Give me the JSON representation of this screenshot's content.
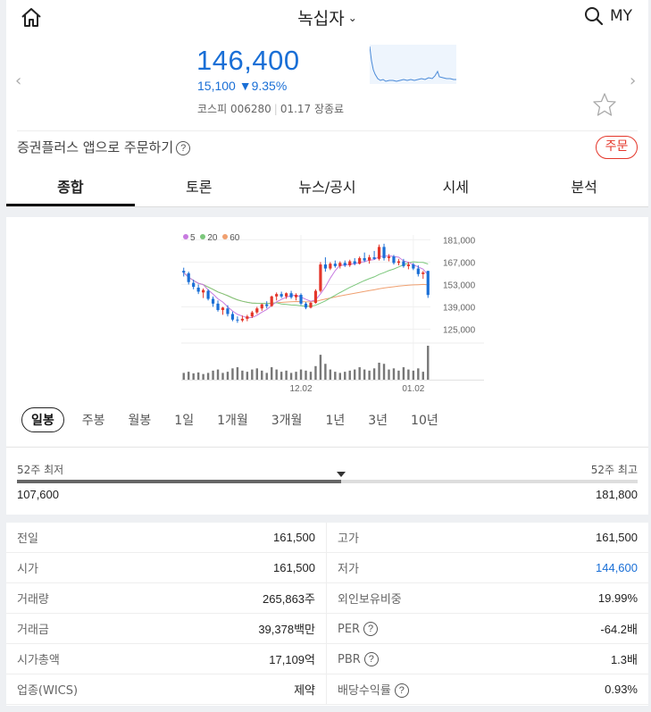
{
  "header": {
    "title": "녹십자",
    "my_label": "MY",
    "icons": {
      "home": "home-icon",
      "search": "search-icon",
      "dropdown": "chevron-down-icon"
    }
  },
  "quote": {
    "price": "146,400",
    "change_amount": "15,100",
    "change_arrow": "▼",
    "change_rate": "9.35%",
    "market": "코스피",
    "code": "006280",
    "date_status": "01.17 장종료",
    "color": "#1a6fd6"
  },
  "order": {
    "text": "증권플러스 앱으로 주문하기",
    "help": "?",
    "button": "주문",
    "button_color": "#e4362a"
  },
  "tabs": [
    {
      "label": "종합",
      "active": true
    },
    {
      "label": "토론",
      "active": false
    },
    {
      "label": "뉴스/공시",
      "active": false
    },
    {
      "label": "시세",
      "active": false
    },
    {
      "label": "분석",
      "active": false
    }
  ],
  "chart_data": {
    "type": "candlestick",
    "legend": [
      {
        "name": "5",
        "color": "#c77be0"
      },
      {
        "name": "20",
        "color": "#7cc77c"
      },
      {
        "name": "60",
        "color": "#f0a070"
      }
    ],
    "y_ticks": [
      "181,000",
      "167,000",
      "153,000",
      "139,000",
      "125,000"
    ],
    "ylim": [
      118000,
      184000
    ],
    "x_ticks": [
      {
        "label": "12.02",
        "index": 24
      },
      {
        "label": "01.02",
        "index": 47
      }
    ],
    "up_color": "#e4362a",
    "down_color": "#1a6fd6",
    "candles": [
      {
        "o": 161500,
        "h": 163500,
        "l": 158000,
        "c": 160500,
        "v": 30
      },
      {
        "o": 160000,
        "h": 161000,
        "l": 153000,
        "c": 154500,
        "v": 35
      },
      {
        "o": 154000,
        "h": 156000,
        "l": 150000,
        "c": 151500,
        "v": 28
      },
      {
        "o": 151000,
        "h": 153000,
        "l": 147000,
        "c": 148500,
        "v": 32
      },
      {
        "o": 148000,
        "h": 150500,
        "l": 144500,
        "c": 149500,
        "v": 25
      },
      {
        "o": 149000,
        "h": 150000,
        "l": 143000,
        "c": 144000,
        "v": 30
      },
      {
        "o": 144000,
        "h": 145500,
        "l": 139000,
        "c": 141000,
        "v": 40
      },
      {
        "o": 141000,
        "h": 143000,
        "l": 136000,
        "c": 137000,
        "v": 45
      },
      {
        "o": 137000,
        "h": 139000,
        "l": 134000,
        "c": 138500,
        "v": 30
      },
      {
        "o": 138000,
        "h": 140000,
        "l": 133000,
        "c": 134500,
        "v": 35
      },
      {
        "o": 134500,
        "h": 136000,
        "l": 130000,
        "c": 131000,
        "v": 50
      },
      {
        "o": 131000,
        "h": 133000,
        "l": 129000,
        "c": 130500,
        "v": 55
      },
      {
        "o": 130500,
        "h": 133500,
        "l": 129500,
        "c": 131500,
        "v": 40
      },
      {
        "o": 131500,
        "h": 134000,
        "l": 130000,
        "c": 133000,
        "v": 35
      },
      {
        "o": 133000,
        "h": 136500,
        "l": 132000,
        "c": 135500,
        "v": 45
      },
      {
        "o": 135500,
        "h": 139000,
        "l": 134500,
        "c": 138000,
        "v": 50
      },
      {
        "o": 138000,
        "h": 141000,
        "l": 136500,
        "c": 140500,
        "v": 40
      },
      {
        "o": 140500,
        "h": 142500,
        "l": 138000,
        "c": 139500,
        "v": 30
      },
      {
        "o": 139500,
        "h": 146000,
        "l": 139000,
        "c": 145500,
        "v": 55
      },
      {
        "o": 145500,
        "h": 148000,
        "l": 143000,
        "c": 147000,
        "v": 45
      },
      {
        "o": 147000,
        "h": 148500,
        "l": 144500,
        "c": 145500,
        "v": 35
      },
      {
        "o": 145500,
        "h": 148000,
        "l": 144000,
        "c": 147500,
        "v": 40
      },
      {
        "o": 147500,
        "h": 149000,
        "l": 144000,
        "c": 145000,
        "v": 30
      },
      {
        "o": 145000,
        "h": 147500,
        "l": 143000,
        "c": 146500,
        "v": 35
      },
      {
        "o": 146500,
        "h": 147500,
        "l": 140000,
        "c": 141000,
        "v": 45
      },
      {
        "o": 141000,
        "h": 142000,
        "l": 137500,
        "c": 138500,
        "v": 40
      },
      {
        "o": 138500,
        "h": 142000,
        "l": 138000,
        "c": 141500,
        "v": 35
      },
      {
        "o": 141500,
        "h": 150000,
        "l": 141000,
        "c": 149000,
        "v": 60
      },
      {
        "o": 149000,
        "h": 167000,
        "l": 148000,
        "c": 165500,
        "v": 110
      },
      {
        "o": 165500,
        "h": 170000,
        "l": 161000,
        "c": 163000,
        "v": 70
      },
      {
        "o": 163000,
        "h": 167000,
        "l": 162000,
        "c": 166000,
        "v": 45
      },
      {
        "o": 166000,
        "h": 168000,
        "l": 163500,
        "c": 164500,
        "v": 35
      },
      {
        "o": 164500,
        "h": 167500,
        "l": 163000,
        "c": 166500,
        "v": 30
      },
      {
        "o": 166500,
        "h": 168000,
        "l": 164000,
        "c": 165000,
        "v": 35
      },
      {
        "o": 165000,
        "h": 168500,
        "l": 164000,
        "c": 167500,
        "v": 40
      },
      {
        "o": 167500,
        "h": 169500,
        "l": 165000,
        "c": 166000,
        "v": 45
      },
      {
        "o": 166000,
        "h": 170500,
        "l": 165500,
        "c": 169500,
        "v": 55
      },
      {
        "o": 169500,
        "h": 173000,
        "l": 167000,
        "c": 168000,
        "v": 45
      },
      {
        "o": 168000,
        "h": 171500,
        "l": 166000,
        "c": 170000,
        "v": 40
      },
      {
        "o": 170000,
        "h": 174000,
        "l": 168500,
        "c": 169000,
        "v": 50
      },
      {
        "o": 169000,
        "h": 178000,
        "l": 168000,
        "c": 176500,
        "v": 75
      },
      {
        "o": 176500,
        "h": 178500,
        "l": 168000,
        "c": 169500,
        "v": 70
      },
      {
        "o": 169500,
        "h": 172000,
        "l": 167500,
        "c": 170500,
        "v": 45
      },
      {
        "o": 170500,
        "h": 171500,
        "l": 165500,
        "c": 166500,
        "v": 50
      },
      {
        "o": 166500,
        "h": 169000,
        "l": 165000,
        "c": 167500,
        "v": 40
      },
      {
        "o": 167500,
        "h": 169000,
        "l": 163500,
        "c": 164500,
        "v": 55
      },
      {
        "o": 164500,
        "h": 167000,
        "l": 162500,
        "c": 165500,
        "v": 45
      },
      {
        "o": 165500,
        "h": 166500,
        "l": 162000,
        "c": 163000,
        "v": 40
      },
      {
        "o": 163000,
        "h": 165000,
        "l": 158000,
        "c": 159500,
        "v": 50
      },
      {
        "o": 159500,
        "h": 161500,
        "l": 156500,
        "c": 160500,
        "v": 35
      },
      {
        "o": 161500,
        "h": 161500,
        "l": 144600,
        "c": 146400,
        "v": 150
      }
    ]
  },
  "periods": [
    {
      "label": "일봉",
      "active": true
    },
    {
      "label": "주봉",
      "active": false
    },
    {
      "label": "월봉",
      "active": false
    },
    {
      "label": "1일",
      "active": false
    },
    {
      "label": "1개월",
      "active": false
    },
    {
      "label": "3개월",
      "active": false
    },
    {
      "label": "1년",
      "active": false
    },
    {
      "label": "3년",
      "active": false
    },
    {
      "label": "10년",
      "active": false
    }
  ],
  "range": {
    "low_label": "52주 최저",
    "high_label": "52주 최고",
    "low_value": "107,600",
    "high_value": "181,800",
    "position_fraction": 0.523
  },
  "info": {
    "rows": [
      [
        {
          "key": "전일",
          "value": "161,500"
        },
        {
          "key": "고가",
          "value": "161,500"
        }
      ],
      [
        {
          "key": "시가",
          "value": "161,500"
        },
        {
          "key": "저가",
          "value": "144,600",
          "blue": true
        }
      ],
      [
        {
          "key": "거래량",
          "value": "265,863주"
        },
        {
          "key": "외인보유비중",
          "value": "19.99%"
        }
      ],
      [
        {
          "key": "거래금",
          "value": "39,378백만"
        },
        {
          "key": "PER",
          "value": "-64.2배",
          "help": true
        }
      ],
      [
        {
          "key": "시가총액",
          "value": "17,109억"
        },
        {
          "key": "PBR",
          "value": "1.3배",
          "help": true
        }
      ],
      [
        {
          "key": "업종(WICS)",
          "value": "제약"
        },
        {
          "key": "배당수익률",
          "value": "0.93%",
          "help": true
        }
      ]
    ]
  }
}
